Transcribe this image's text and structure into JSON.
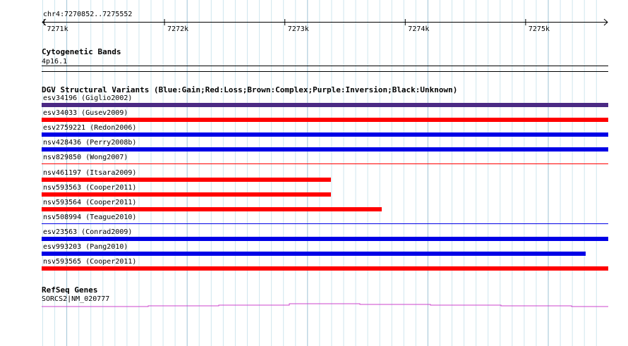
{
  "ruler": {
    "location": "chr4:7270852..7275552",
    "ticks": [
      "7271k",
      "7272k",
      "7273k",
      "7274k",
      "7275k"
    ]
  },
  "cytoband": {
    "title": "Cytogenetic Bands",
    "band": "4p16.1"
  },
  "dgv": {
    "title": "DGV Structural Variants (Blue:Gain;Red:Loss;Brown:Complex;Purple:Inversion;Black:Unknown)",
    "colors": {
      "Gain": "#0000e6",
      "Loss": "#ff0000",
      "Inversion": "#4b2a84",
      "Unknown": "#000000"
    },
    "features": [
      {
        "label": "esv34196 (Giglio2002)",
        "type": "Inversion",
        "color": "#4b2a84",
        "coverage": 1.0,
        "style": "thick"
      },
      {
        "label": "esv34033 (Gusev2009)",
        "type": "Loss",
        "color": "#ff0000",
        "coverage": 1.0,
        "style": "thick"
      },
      {
        "label": "esv2759221 (Redon2006)",
        "type": "Gain",
        "color": "#0000e6",
        "coverage": 1.0,
        "style": "thick"
      },
      {
        "label": "nsv428436 (Perry2008b)",
        "type": "Gain",
        "color": "#0000e6",
        "coverage": 1.0,
        "style": "thick"
      },
      {
        "label": "nsv829850 (Wong2007)",
        "type": "Loss",
        "color": "#ff0000",
        "coverage": 1.0,
        "style": "thin"
      },
      {
        "label": "nsv461197 (Itsara2009)",
        "type": "Loss",
        "color": "#ff0000",
        "coverage": 0.51,
        "style": "thick"
      },
      {
        "label": "nsv593563 (Cooper2011)",
        "type": "Loss",
        "color": "#ff0000",
        "coverage": 0.51,
        "style": "thick"
      },
      {
        "label": "nsv593564 (Cooper2011)",
        "type": "Loss",
        "color": "#ff0000",
        "coverage": 0.6,
        "style": "thick"
      },
      {
        "label": "nsv508994 (Teague2010)",
        "type": "Gain",
        "color": "#0000e6",
        "coverage": 1.0,
        "style": "thin"
      },
      {
        "label": "esv23563 (Conrad2009)",
        "type": "Gain",
        "color": "#0000e6",
        "coverage": 1.0,
        "style": "thick"
      },
      {
        "label": "esv993203 (Pang2010)",
        "type": "Gain",
        "color": "#0000e6",
        "coverage": 0.96,
        "style": "thick"
      },
      {
        "label": "nsv593565 (Cooper2011)",
        "type": "Loss",
        "color": "#ff0000",
        "coverage": 1.0,
        "style": "thick"
      }
    ]
  },
  "refseq": {
    "title": "RefSeq Genes",
    "gene": "SORCS2|NM_020777",
    "color": "#cc44cc"
  }
}
